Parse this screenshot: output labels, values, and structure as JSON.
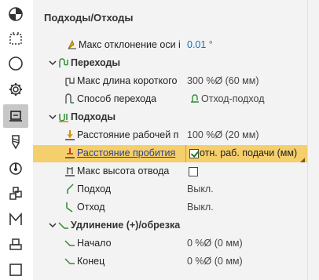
{
  "toolbar": {
    "items": [
      {
        "name": "hemisphere-icon"
      },
      {
        "name": "selection-box-icon"
      },
      {
        "name": "compass-icon"
      },
      {
        "name": "gear-icon"
      },
      {
        "name": "links-icon",
        "active": true
      },
      {
        "name": "tool-icon"
      },
      {
        "name": "spindle-icon"
      },
      {
        "name": "stacked-blocks-icon"
      },
      {
        "name": "letter-m-icon"
      },
      {
        "name": "stamp-icon"
      },
      {
        "name": "square-icon"
      }
    ]
  },
  "panel": {
    "title": "Подходы/Отходы",
    "rows": {
      "max_axis_dev": {
        "label": "Макс отклонение оси i",
        "value": "0.01 °"
      },
      "transitions": {
        "label": "Переходы"
      },
      "max_short_len": {
        "label": "Макс длина короткого",
        "value": "300 %Ø (60 мм)"
      },
      "transition_method": {
        "label": "Способ перехода",
        "value": "Отход-подход"
      },
      "approaches": {
        "label": "Подходы"
      },
      "work_approach_dist": {
        "label": "Расстояние рабочей п",
        "value": "100 %Ø (20 мм)"
      },
      "pierce_dist": {
        "label": "Расстояние пробития",
        "value": "отн. раб. подачи (мм)"
      },
      "max_retract_height": {
        "label": "Макс высота отвода"
      },
      "approach": {
        "label": "Подход",
        "value": "Выкл."
      },
      "retract": {
        "label": "Отход",
        "value": "Выкл."
      },
      "extension": {
        "label": "Удлинение (+)/обрезка"
      },
      "start": {
        "label": "Начало",
        "value": "0 %Ø (0 мм)"
      },
      "end": {
        "label": "Конец",
        "value": "0 %Ø (0 мм)"
      }
    }
  },
  "colors": {
    "highlight": "#f5cf6b",
    "link": "#1a6fb5",
    "accent_orange": "#e08a00",
    "icon_green": "#2e8b2e"
  }
}
